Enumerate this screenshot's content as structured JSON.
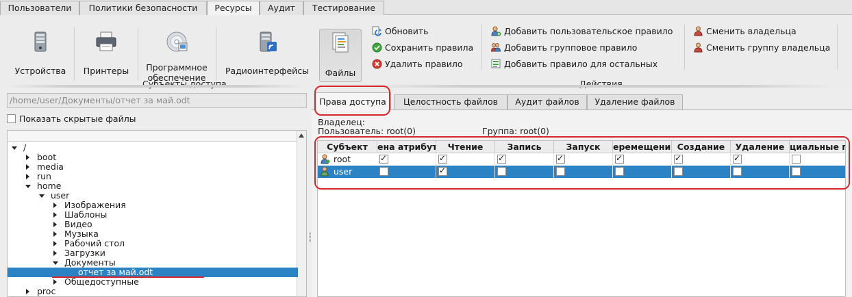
{
  "top_tabs": [
    {
      "label": "Пользователи"
    },
    {
      "label": "Политики безопасности"
    },
    {
      "label": "Ресурсы"
    },
    {
      "label": "Аудит"
    },
    {
      "label": "Тестирование"
    }
  ],
  "active_top_tab": "Ресурсы",
  "ribbon": {
    "buttons": [
      {
        "label": "Устройства",
        "icon": "hard-drive-icon"
      },
      {
        "label": "Принтеры",
        "icon": "printer-icon"
      },
      {
        "label": "Программное обеспечение",
        "icon": "cd-disc-icon"
      },
      {
        "label": "Радиоинтерфейсы",
        "icon": "wireless-drive-icon"
      },
      {
        "label": "Файлы",
        "icon": "files-icon"
      }
    ],
    "pressed_button": "Файлы",
    "actions_col1": [
      {
        "label": "Обновить",
        "icon": "refresh-icon"
      },
      {
        "label": "Сохранить правила",
        "icon": "check-icon"
      },
      {
        "label": "Удалить правило",
        "icon": "delete-icon"
      }
    ],
    "actions_col2": [
      {
        "label": "Добавить пользовательское правило",
        "icon": "add-user-icon"
      },
      {
        "label": "Добавить групповое правило",
        "icon": "add-group-icon"
      },
      {
        "label": "Добавить правило для остальных",
        "icon": "add-others-icon"
      }
    ],
    "actions_col3": [
      {
        "label": "Сменить владельца",
        "icon": "owner-icon"
      },
      {
        "label": "Сменить группу владельца",
        "icon": "owner-group-icon"
      }
    ],
    "section_subjects": "Субъекты доступа",
    "section_actions": "Действия"
  },
  "left": {
    "path": "/home/user/Документы/отчет за май.odt",
    "show_hidden_label": "Показать скрытые файлы",
    "show_hidden_checked": false,
    "tree": [
      {
        "label": "/",
        "level": 0,
        "state": "expanded"
      },
      {
        "label": "boot",
        "level": 1,
        "state": "collapsed"
      },
      {
        "label": "media",
        "level": 1,
        "state": "collapsed"
      },
      {
        "label": "run",
        "level": 1,
        "state": "collapsed"
      },
      {
        "label": "home",
        "level": 1,
        "state": "expanded"
      },
      {
        "label": "user",
        "level": 2,
        "state": "expanded"
      },
      {
        "label": "Изображения",
        "level": 3,
        "state": "collapsed"
      },
      {
        "label": "Шаблоны",
        "level": 3,
        "state": "collapsed"
      },
      {
        "label": "Видео",
        "level": 3,
        "state": "collapsed"
      },
      {
        "label": "Музыка",
        "level": 3,
        "state": "collapsed"
      },
      {
        "label": "Рабочий стол",
        "level": 3,
        "state": "collapsed"
      },
      {
        "label": "Загрузки",
        "level": 3,
        "state": "collapsed"
      },
      {
        "label": "Документы",
        "level": 3,
        "state": "expanded"
      },
      {
        "label": "отчет за май.odt",
        "level": 4,
        "state": "leaf",
        "selected": true
      },
      {
        "label": "Общедоступные",
        "level": 3,
        "state": "collapsed"
      },
      {
        "label": "proc",
        "level": 1,
        "state": "collapsed"
      }
    ]
  },
  "right": {
    "tabs": [
      {
        "label": "Права доступа"
      },
      {
        "label": "Целостность файлов"
      },
      {
        "label": "Аудит файлов"
      },
      {
        "label": "Удаление файлов"
      }
    ],
    "active_tab": "Права доступа",
    "owner_label": "Владелец:",
    "owner_user": "Пользователь: root(0)",
    "owner_group": "Группа: root(0)",
    "columns": [
      "Субъект",
      "ена атрибут",
      "Чтение",
      "Запись",
      "Запуск",
      "еремещени",
      "Создание",
      "Удаление",
      "циальные пр"
    ],
    "rows": [
      {
        "subject": "root",
        "values": [
          true,
          true,
          true,
          true,
          true,
          true,
          true,
          false
        ],
        "selected": false
      },
      {
        "subject": "user",
        "values": [
          false,
          true,
          false,
          false,
          false,
          false,
          false,
          false
        ],
        "selected": true
      }
    ]
  },
  "colors": {
    "selection": "#2b83c6",
    "annotation": "#d8262b"
  }
}
